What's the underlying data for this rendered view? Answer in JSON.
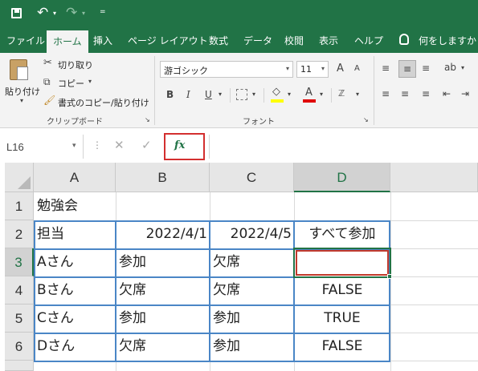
{
  "titlebar": {
    "more": "="
  },
  "tabs": [
    "ファイル",
    "ホーム",
    "挿入",
    "ページ レイアウト",
    "数式",
    "データ",
    "校閲",
    "表示",
    "ヘルプ"
  ],
  "tell_me": "何をしますか",
  "ribbon": {
    "paste": "貼り付け",
    "cut": "切り取り",
    "copy": "コピー",
    "format_painter": "書式のコピー/貼り付け",
    "clipboard_group": "クリップボード",
    "font_name": "游ゴシック",
    "font_size": "11",
    "bold": "B",
    "italic": "I",
    "underline": "U",
    "font_color": "A",
    "font_group": "フォント",
    "grow_font": "A",
    "shrink_font": "A"
  },
  "formula_bar": {
    "name_box": "L16",
    "fx": "fx",
    "value": ""
  },
  "columns": [
    "A",
    "B",
    "C",
    "D"
  ],
  "rows": [
    "1",
    "2",
    "3",
    "4",
    "5",
    "6"
  ],
  "cells": {
    "A1": "勉強会",
    "A2": "担当",
    "B2": "2022/4/1",
    "C2": "2022/4/5",
    "D2": "すべて参加",
    "A3": "Aさん",
    "B3": "参加",
    "C3": "欠席",
    "D3": "",
    "A4": "Bさん",
    "B4": "欠席",
    "C4": "欠席",
    "D4": "FALSE",
    "A5": "Cさん",
    "B5": "参加",
    "C5": "参加",
    "D5": "TRUE",
    "A6": "Dさん",
    "B6": "欠席",
    "C6": "参加",
    "D6": "FALSE"
  },
  "colors": {
    "excel_green": "#217346",
    "selection_red": "#c0392b",
    "table_border": "#4a86c6"
  }
}
